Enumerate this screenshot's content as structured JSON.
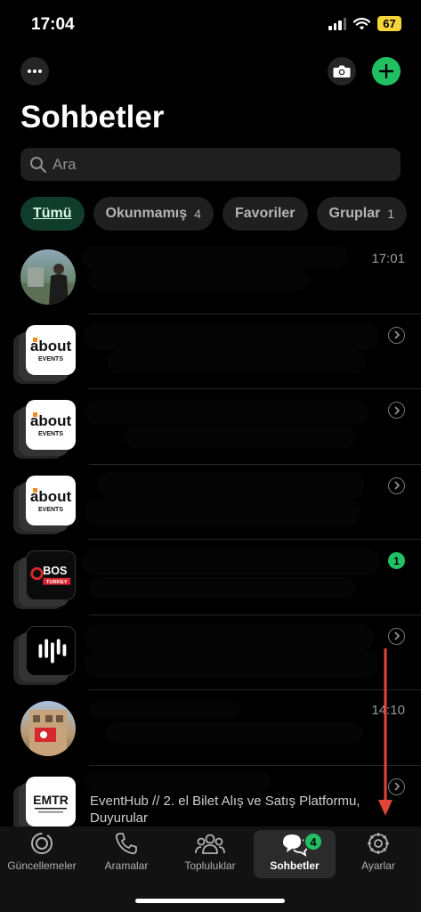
{
  "status_bar": {
    "time": "17:04",
    "battery": "67"
  },
  "header": {
    "title": "Sohbetler"
  },
  "search": {
    "placeholder": "Ara"
  },
  "filters": [
    {
      "label": "Tümü",
      "count": ""
    },
    {
      "label": "Okunmamış",
      "count": "4"
    },
    {
      "label": "Favoriler",
      "count": ""
    },
    {
      "label": "Gruplar",
      "count": "1"
    }
  ],
  "chats": [
    {
      "time": "17:01",
      "unread": ""
    },
    {
      "time": "",
      "unread": "",
      "logo": "about EVENTS"
    },
    {
      "time": "",
      "unread": "",
      "logo": "about EVENTS"
    },
    {
      "time": "",
      "unread": "",
      "logo": "about EVENTS"
    },
    {
      "time": "",
      "unread": "1",
      "logo": "BOS TURKEY"
    },
    {
      "time": "",
      "unread": ""
    },
    {
      "time": "14:10",
      "unread": ""
    },
    {
      "time": "",
      "unread": "",
      "logo": "EMTR",
      "message": "EventHub // 2. el Bilet Alış ve Satış Platformu, Duyurular"
    }
  ],
  "tabs": [
    {
      "label": "Güncellemeler",
      "icon": "updates-icon"
    },
    {
      "label": "Aramalar",
      "icon": "phone-icon"
    },
    {
      "label": "Topluluklar",
      "icon": "communities-icon"
    },
    {
      "label": "Sohbetler",
      "icon": "chats-icon",
      "badge": "4"
    },
    {
      "label": "Ayarlar",
      "icon": "settings-icon"
    }
  ],
  "colors": {
    "accent": "#21c063",
    "active_chip": "#103d2b",
    "annotation_arrow": "#e0453a"
  }
}
